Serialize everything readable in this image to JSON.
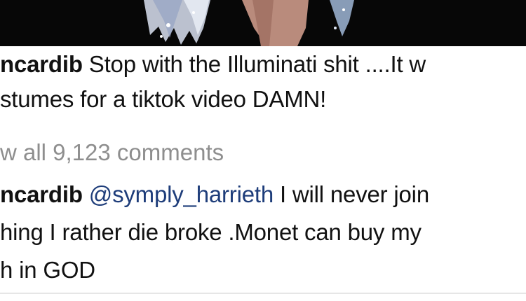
{
  "post": {
    "caption": {
      "username": "ncardib",
      "line1_text": " Stop with the Illuminati shit ....It w",
      "line2_text": "stumes for a tiktok video DAMN!"
    },
    "view_all_comments": "w all 9,123 comments",
    "comment": {
      "username": "ncardib",
      "mention": "@symply_harrieth",
      "line1_text": " I will never join",
      "line2_text": "hing I rather die broke .Monet can buy my",
      "line3_text": "h in GOD"
    }
  },
  "colors": {
    "mention": "#1e3d7a",
    "muted": "#8e8e8e",
    "text": "#111111"
  }
}
